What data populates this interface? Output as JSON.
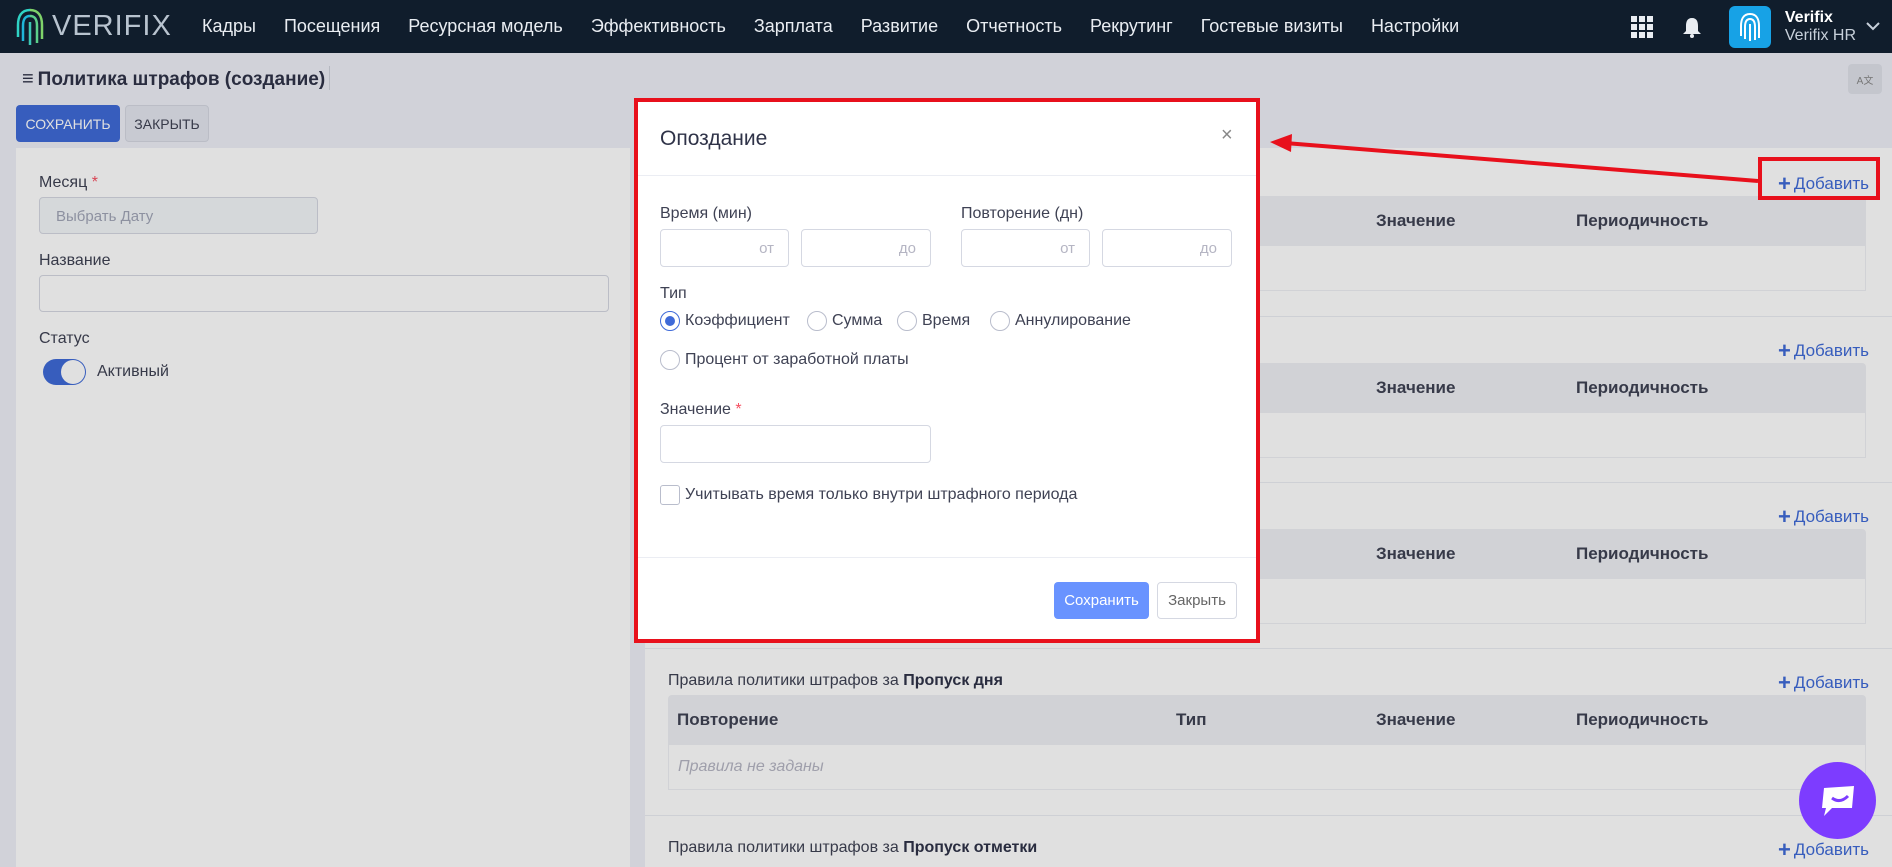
{
  "brand": {
    "logo_text": "VERIFIX"
  },
  "nav": [
    "Кадры",
    "Посещения",
    "Ресурсная модель",
    "Эффективность",
    "Зарплата",
    "Развитие",
    "Отчетность",
    "Рекрутинг",
    "Гостевые визиты",
    "Настройки"
  ],
  "user": {
    "name": "Verifix",
    "org": "Verifix HR"
  },
  "page": {
    "title": "Политика штрафов (создание)",
    "save_label": "СОХРАНИТЬ",
    "close_label": "ЗАКРЫТЬ"
  },
  "form": {
    "month_label": "Месяц",
    "month_placeholder": "Выбрать Дату",
    "name_label": "Название",
    "status_label": "Статус",
    "status_value": "Активный",
    "required_mark": "*"
  },
  "sections": [
    {
      "add_label": "Добавить",
      "cols": [
        "Значение",
        "Периодичность"
      ]
    },
    {
      "add_label": "Добавить",
      "cols": [
        "Значение",
        "Периодичность"
      ]
    },
    {
      "add_label": "Добавить",
      "cols": [
        "Значение",
        "Периодичность"
      ]
    },
    {
      "title_prefix": "Правила политики штрафов за",
      "title_bold": "Пропуск дня",
      "add_label": "Добавить",
      "cols": [
        "Повторение",
        "Тип",
        "Значение",
        "Периодичность"
      ],
      "empty": "Правила не заданы"
    },
    {
      "title_prefix": "Правила политики штрафов за",
      "title_bold": "Пропуск отметки",
      "add_label": "Добавить"
    }
  ],
  "modal": {
    "title": "Опоздание",
    "close_glyph": "×",
    "time_label": "Время (мин)",
    "repeat_label": "Повторение (дн)",
    "from_hint": "от",
    "to_hint": "до",
    "type_label": "Тип",
    "types": [
      "Коэффициент",
      "Сумма",
      "Время",
      "Аннулирование",
      "Процент от заработной платы"
    ],
    "selected_type": "Коэффициент",
    "value_label": "Значение",
    "checkbox_label": "Учитывать время только внутри штрафного периода",
    "save_label": "Сохранить",
    "cancel_label": "Закрыть"
  },
  "colors": {
    "accent": "#3f6ad8",
    "topbar": "#101d2c",
    "highlight": "#e8101c",
    "chat": "#7d3cff"
  }
}
